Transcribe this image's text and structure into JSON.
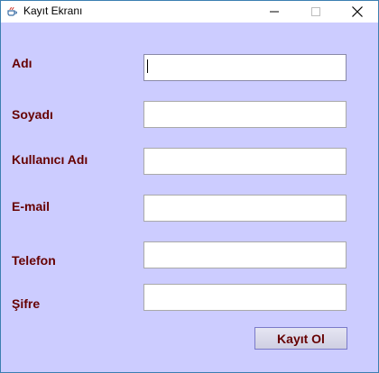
{
  "window": {
    "title": "Kayıt Ekranı",
    "icon": "java-cup-icon",
    "controls": [
      "minimize-icon",
      "maximize-icon",
      "close-icon"
    ]
  },
  "form": {
    "fields": [
      {
        "label": "Adı",
        "value": "",
        "focused": true
      },
      {
        "label": "Soyadı",
        "value": ""
      },
      {
        "label": "Kullanıcı Adı",
        "value": ""
      },
      {
        "label": "E-mail",
        "value": ""
      },
      {
        "label": "Telefon",
        "value": ""
      },
      {
        "label": "Şifre",
        "value": ""
      }
    ],
    "submit_label": "Kayıt Ol"
  },
  "colors": {
    "background": "#ccccff",
    "label_text": "#660000",
    "window_border": "#3c7fb1"
  }
}
